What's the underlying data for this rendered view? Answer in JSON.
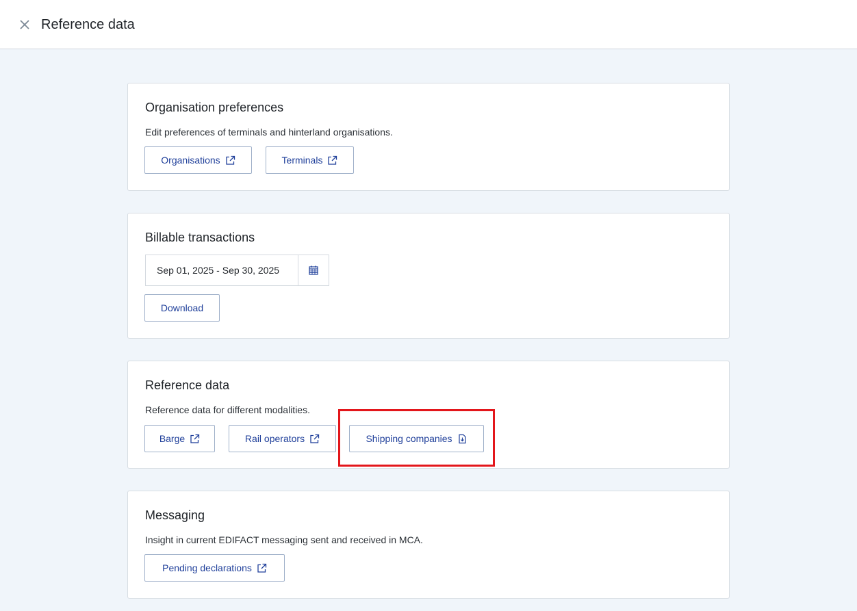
{
  "header": {
    "title": "Reference data",
    "close_icon": "close-icon"
  },
  "sections": {
    "org": {
      "title": "Organisation preferences",
      "description": "Edit preferences of terminals and hinterland organisations.",
      "buttons": [
        {
          "label": "Organisations",
          "icon": "external-link-icon"
        },
        {
          "label": "Terminals",
          "icon": "external-link-icon"
        }
      ]
    },
    "billable": {
      "title": "Billable transactions",
      "date_range": "Sep 01, 2025 - Sep 30, 2025",
      "calendar_icon": "calendar-icon",
      "download_label": "Download"
    },
    "reference": {
      "title": "Reference data",
      "description": "Reference data for different modalities.",
      "buttons": [
        {
          "label": "Barge",
          "icon": "external-link-icon"
        },
        {
          "label": "Rail operators",
          "icon": "external-link-icon"
        },
        {
          "label": "Shipping companies",
          "icon": "file-download-icon"
        }
      ]
    },
    "messaging": {
      "title": "Messaging",
      "description": "Insight in current EDIFACT messaging sent and received in MCA.",
      "buttons": [
        {
          "label": "Pending declarations",
          "icon": "external-link-icon"
        }
      ]
    }
  },
  "colors": {
    "accent": "#1f3f9a",
    "highlight": "#e3161b",
    "background": "#f0f5fa"
  }
}
